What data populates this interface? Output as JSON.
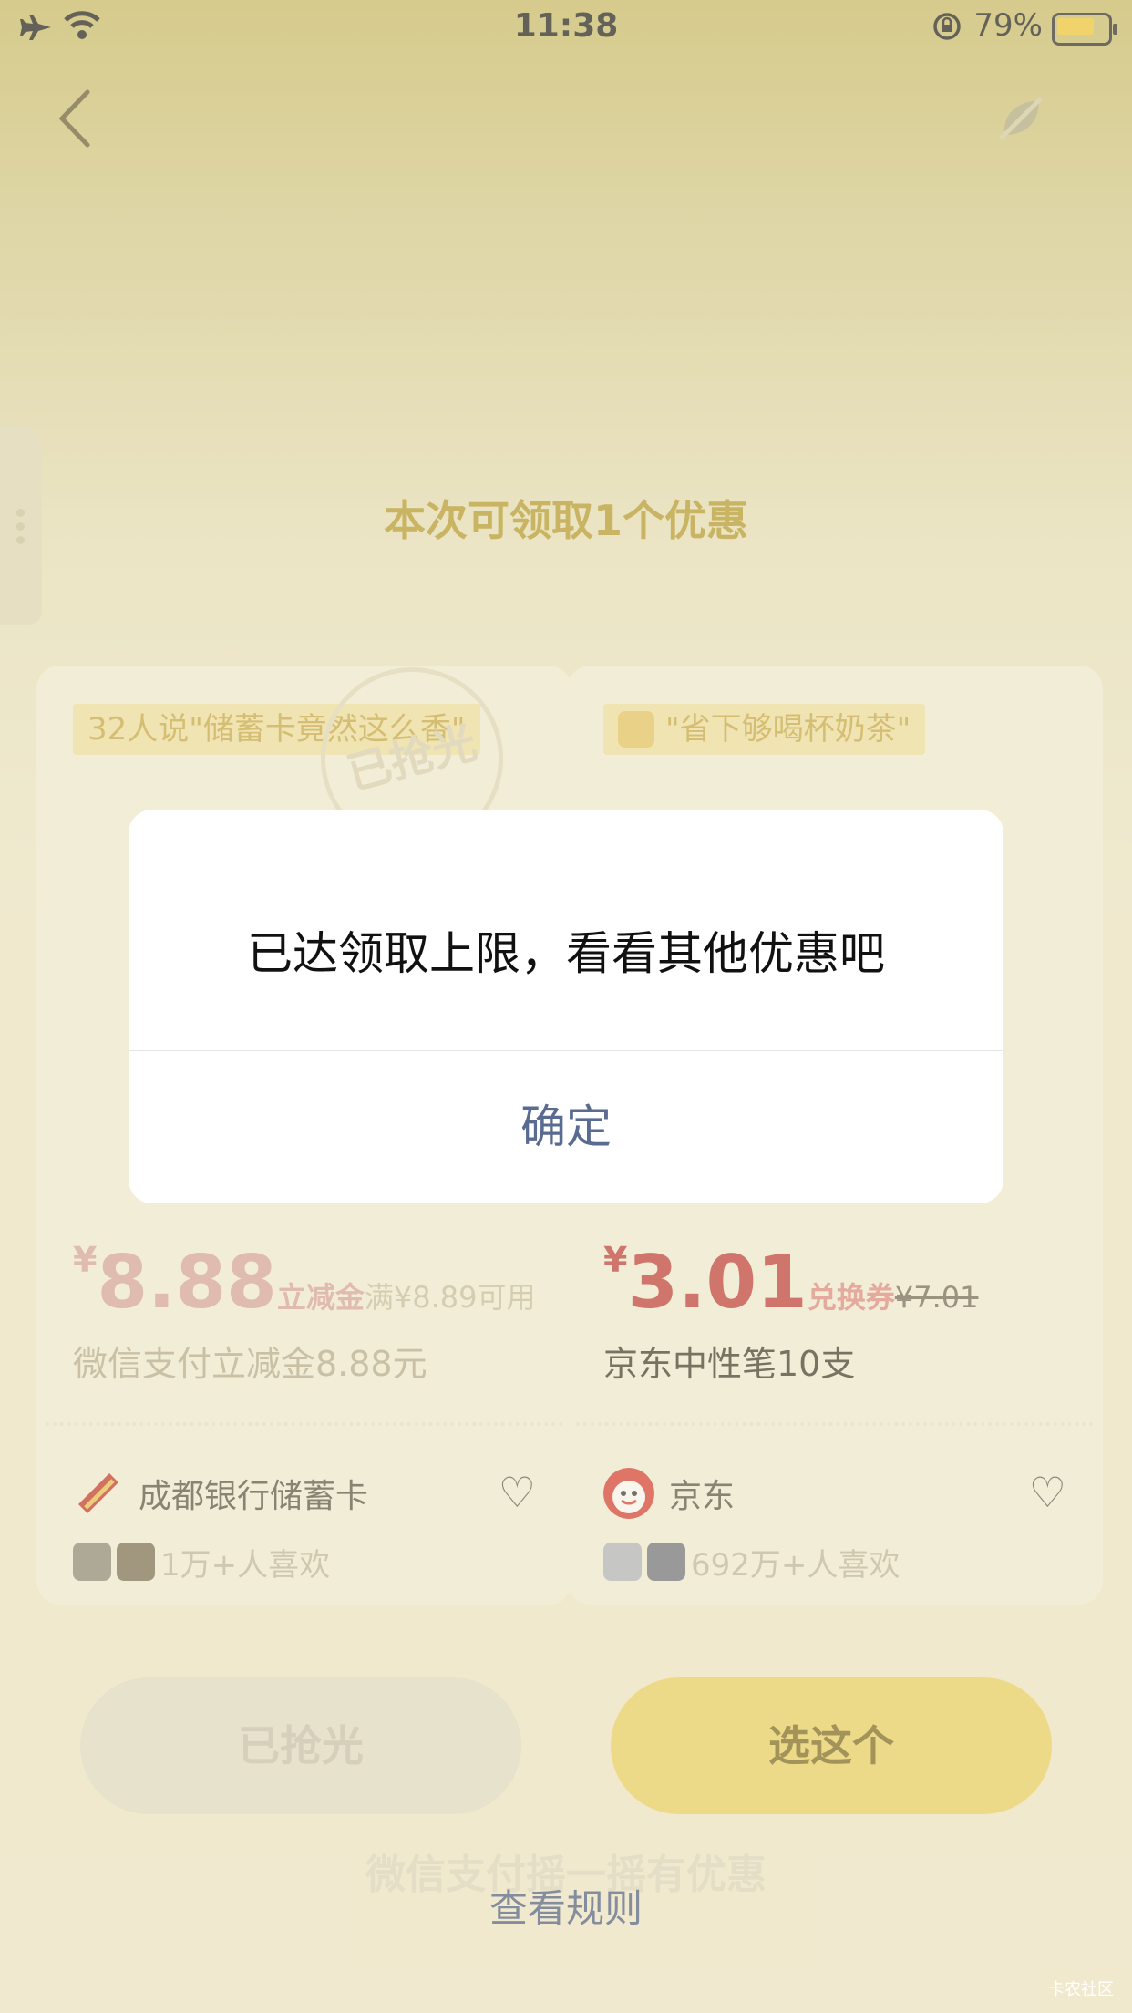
{
  "status_bar": {
    "time": "11:38",
    "battery_percent": "79%",
    "battery_level": 0.79,
    "battery_color": "#f4c93a"
  },
  "nav": {
    "back_icon": "chevron-left-icon",
    "right_icon": "leaf-off-icon"
  },
  "page": {
    "title": "本次可领取1个优惠"
  },
  "cards": [
    {
      "tag": "32人说\"储蓄卡竟然这么香\"",
      "stamp": "已抢光",
      "price_yen": "¥",
      "price": "8.88",
      "price_type": "立减金",
      "price_condition": "满¥8.89可用",
      "product_name": "微信支付立减金8.88元",
      "merchant": "成都银行储蓄卡",
      "likes": "1万+人喜欢"
    },
    {
      "tag": "\"省下够喝杯奶茶\"",
      "price_yen": "¥",
      "price": "3.01",
      "price_type": "兑换券",
      "price_original": "¥7.01",
      "product_name": "京东中性笔10支",
      "merchant": "京东",
      "likes": "692万+人喜欢"
    }
  ],
  "buttons": {
    "left": "已抢光",
    "right": "选这个"
  },
  "footer": {
    "brand": "微信支付摇一摇有优惠",
    "rules_link": "查看规则"
  },
  "dialog": {
    "message": "已达领取上限，看看其他优惠吧",
    "confirm": "确定"
  },
  "watermark": "卡农社区",
  "colors": {
    "accent_yellow": "#eed467",
    "price_red": "#d23a3a",
    "link_blue": "#5a6b91"
  }
}
